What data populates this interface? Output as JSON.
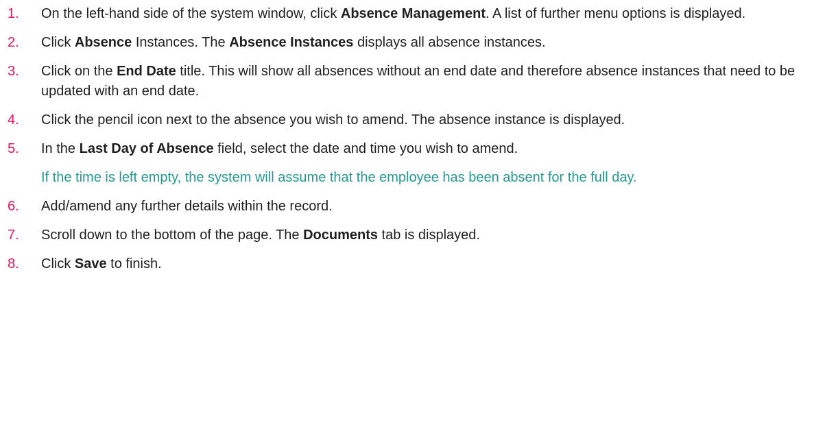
{
  "steps": [
    {
      "number": "1.",
      "parts": [
        "On the left-hand side of the system window, click ",
        "Absence Management",
        ". A list of further menu options is displayed."
      ]
    },
    {
      "number": "2.",
      "parts": [
        "Click ",
        "Absence",
        " Instances. The ",
        "Absence Instances",
        " displays all absence instances."
      ]
    },
    {
      "number": "3.",
      "parts": [
        "Click on the ",
        "End Date",
        " title. This will show all absences without an end date and therefore absence instances that need to be updated with an end date."
      ]
    },
    {
      "number": "4.",
      "parts": [
        "Click the pencil icon next to the absence you wish to amend. The absence instance is displayed."
      ]
    },
    {
      "number": "5.",
      "parts": [
        "In the ",
        "Last Day of Absence",
        " field, select the date and time you wish to amend."
      ],
      "note": "If the time is left empty, the system will assume that the employee has been absent for the full day."
    },
    {
      "number": "6.",
      "parts": [
        "Add/amend any further details within the record."
      ]
    },
    {
      "number": "7.",
      "parts": [
        "Scroll down to the bottom of the page. The ",
        "Documents",
        " tab is displayed."
      ]
    },
    {
      "number": "8.",
      "parts": [
        "Click ",
        "Save",
        " to finish."
      ]
    }
  ],
  "colors": {
    "step_number": "#e2185b",
    "note": "#26978f",
    "body_text": "#1f1f1f"
  }
}
